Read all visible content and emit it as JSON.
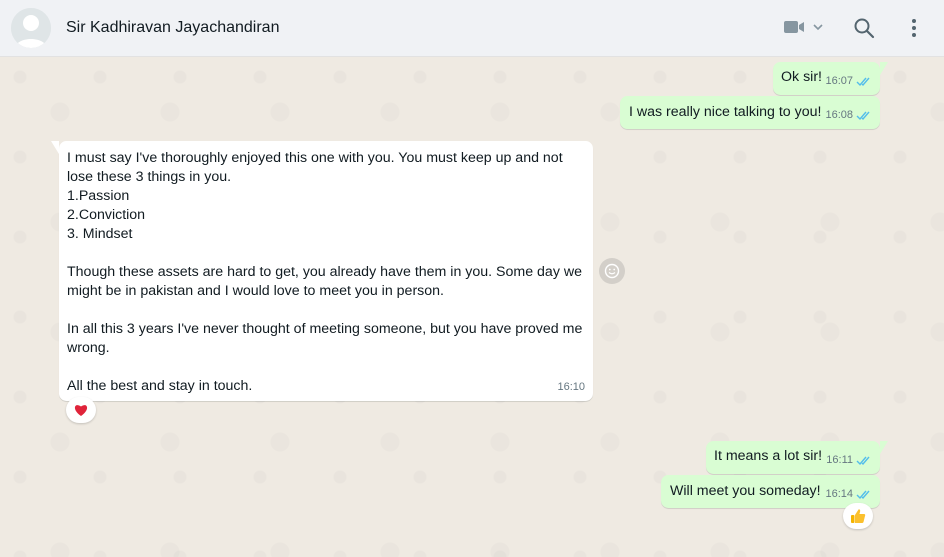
{
  "header": {
    "contact_name": "Sir Kadhiravan Jayachandiran",
    "icons": [
      "avatar-placeholder",
      "video-call-icon",
      "chevron-down-icon",
      "search-icon",
      "menu-icon"
    ]
  },
  "colors": {
    "outgoing_bubble": "#d9fdd3",
    "incoming_bubble": "#ffffff",
    "chat_background": "#efeae2",
    "read_ticks": "#53bdeb",
    "header_bg": "#f0f2f5"
  },
  "messages": [
    {
      "direction": "out",
      "text": "Ok sir!",
      "time": "16:07",
      "status": "read"
    },
    {
      "direction": "out",
      "text": "I was really nice talking to you!",
      "time": "16:08",
      "status": "read"
    },
    {
      "direction": "in",
      "text": "I must say I've thoroughly enjoyed this one with you. You must keep up and not lose these 3 things in you.\n1.Passion\n2.Conviction\n3. Mindset\n\nThough these assets are hard to get, you already have them in you. Some day we might be in pakistan and I would love to meet you in person.\n\nIn all this 3 years I've never thought of meeting someone, but you have proved me wrong.\n\nAll the best and stay in touch.",
      "time": "16:10",
      "reaction": "❤️"
    },
    {
      "direction": "out",
      "text": "It means a lot sir!",
      "time": "16:11",
      "status": "read"
    },
    {
      "direction": "out",
      "text": "Will meet you someday!",
      "time": "16:14",
      "status": "read",
      "reaction": "👍"
    }
  ]
}
